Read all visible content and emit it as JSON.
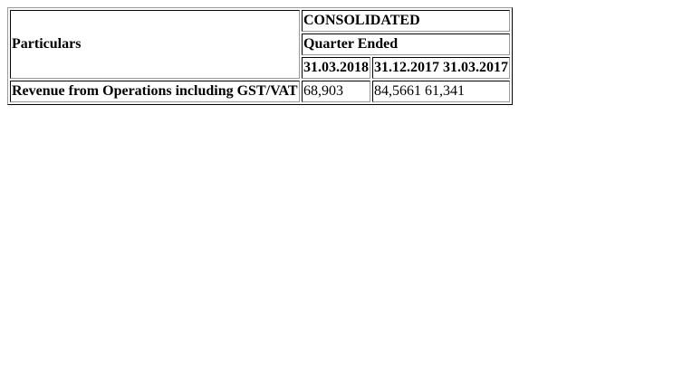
{
  "table": {
    "particulars_header": "Particulars",
    "group_header": "CONSOLIDATED",
    "period_header": "Quarter Ended",
    "columns": [
      "31.03.2018",
      "31.12.2017 31.03.2017"
    ],
    "rows": [
      {
        "label": "Revenue from Operations including GST/VAT",
        "values": [
          "68,903",
          "84,5661 61,341"
        ]
      }
    ]
  }
}
